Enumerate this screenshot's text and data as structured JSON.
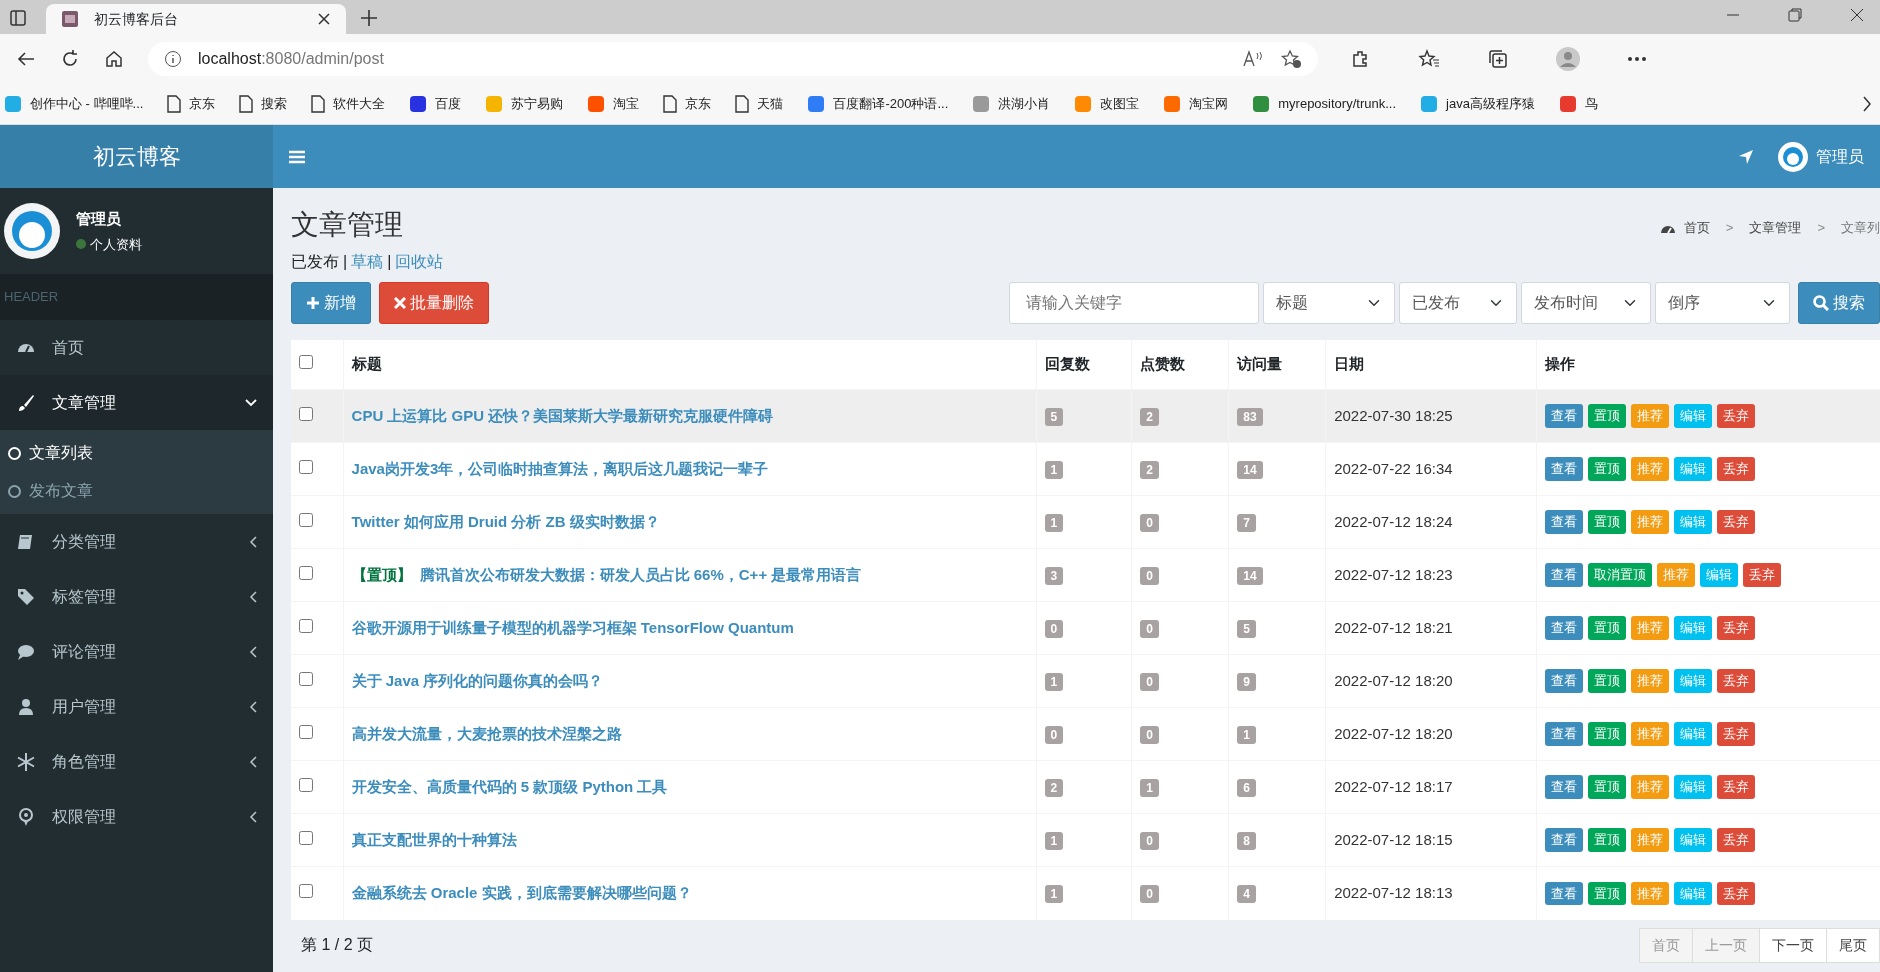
{
  "browser": {
    "tab_title": "初云博客后台",
    "url_host": "localhost",
    "url_rest": ":8080/admin/post",
    "bookmarks": [
      {
        "label": "创作中心 - 哔哩哔...",
        "kind": "site",
        "color": "#23ade5"
      },
      {
        "label": "京东",
        "kind": "page"
      },
      {
        "label": "搜索",
        "kind": "page"
      },
      {
        "label": "软件大全",
        "kind": "page"
      },
      {
        "label": "百度",
        "kind": "site",
        "color": "#2932e1"
      },
      {
        "label": "苏宁易购",
        "kind": "site",
        "color": "#f5b400"
      },
      {
        "label": "淘宝",
        "kind": "site",
        "color": "#ff5000"
      },
      {
        "label": "京东",
        "kind": "page"
      },
      {
        "label": "天猫",
        "kind": "page"
      },
      {
        "label": "百度翻译-200种语...",
        "kind": "site",
        "color": "#2e7cf6"
      },
      {
        "label": "洪湖小肖",
        "kind": "site",
        "color": "#9a9a9a"
      },
      {
        "label": "改图宝",
        "kind": "site",
        "color": "#ff8a00"
      },
      {
        "label": "淘宝网",
        "kind": "site",
        "color": "#ff6a00"
      },
      {
        "label": "myrepository/trunk...",
        "kind": "site",
        "color": "#2f8f3f"
      },
      {
        "label": "java高级程序猿",
        "kind": "site",
        "color": "#23ade5"
      },
      {
        "label": "鸟",
        "kind": "site",
        "color": "#e63b2e"
      }
    ]
  },
  "header": {
    "brand": "初云博客",
    "user": "管理员"
  },
  "sidebar": {
    "user": "管理员",
    "status": "个人资料",
    "section": "HEADER",
    "items": [
      {
        "label": "首页",
        "kind": "dashboard"
      },
      {
        "label": "文章管理",
        "kind": "brush",
        "expanded": true,
        "children": [
          {
            "label": "文章列表",
            "selected": true
          },
          {
            "label": "发布文章",
            "selected": false
          }
        ]
      },
      {
        "label": "分类管理",
        "kind": "book",
        "expanded": false
      },
      {
        "label": "标签管理",
        "kind": "tag",
        "expanded": false
      },
      {
        "label": "评论管理",
        "kind": "comment",
        "expanded": false
      },
      {
        "label": "用户管理",
        "kind": "user",
        "expanded": false
      },
      {
        "label": "角色管理",
        "kind": "snow",
        "expanded": false
      },
      {
        "label": "权限管理",
        "kind": "pin",
        "expanded": false
      }
    ]
  },
  "page": {
    "title": "文章管理",
    "breadcrumb": [
      "首页",
      "文章管理",
      "文章列"
    ],
    "breadcrumb_separators": [
      ">",
      ">"
    ],
    "filter_separators": [
      "|",
      "|"
    ],
    "filters": [
      {
        "label": "已发布",
        "selected": true
      },
      {
        "label": "草稿",
        "selected": false
      },
      {
        "label": "回收站",
        "selected": false
      }
    ],
    "add_button": "新增",
    "delete_button": "批量删除",
    "search": {
      "placeholder": "请输入关键字",
      "selects": [
        "标题",
        "已发布",
        "发布时间",
        "倒序"
      ],
      "button": "搜索"
    }
  },
  "table": {
    "select_all": {
      "checked": false
    },
    "columns": [
      "标题",
      "回复数",
      "点赞数",
      "访问量",
      "日期",
      "操作"
    ],
    "rows": [
      {
        "checked": false,
        "hovered": true,
        "title": "CPU 上运算比 GPU 还快？美国莱斯大学最新研究克服硬件障碍",
        "replies": "5",
        "likes": "2",
        "views": "83",
        "date": "2022-07-30 18:25",
        "actions": [
          {
            "label": "查看",
            "kind": "view"
          },
          {
            "label": "置顶",
            "kind": "pin"
          },
          {
            "label": "推荐",
            "kind": "recommend"
          },
          {
            "label": "编辑",
            "kind": "edit"
          },
          {
            "label": "丢弃",
            "kind": "discard"
          }
        ]
      },
      {
        "checked": false,
        "hovered": false,
        "title": "Java岗开发3年，公司临时抽查算法，离职后这几题我记一辈子",
        "replies": "1",
        "likes": "2",
        "views": "14",
        "date": "2022-07-22 16:34",
        "actions": [
          {
            "label": "查看",
            "kind": "view"
          },
          {
            "label": "置顶",
            "kind": "pin"
          },
          {
            "label": "推荐",
            "kind": "recommend"
          },
          {
            "label": "编辑",
            "kind": "edit"
          },
          {
            "label": "丢弃",
            "kind": "discard"
          }
        ]
      },
      {
        "checked": false,
        "hovered": false,
        "title": "Twitter 如何应用 Druid 分析 ZB 级实时数据？",
        "replies": "1",
        "likes": "0",
        "views": "7",
        "date": "2022-07-12 18:24",
        "actions": [
          {
            "label": "查看",
            "kind": "view"
          },
          {
            "label": "置顶",
            "kind": "pin"
          },
          {
            "label": "推荐",
            "kind": "recommend"
          },
          {
            "label": "编辑",
            "kind": "edit"
          },
          {
            "label": "丢弃",
            "kind": "discard"
          }
        ]
      },
      {
        "checked": false,
        "hovered": false,
        "tag": "【置顶】",
        "title": "腾讯首次公布研发大数据：研发人员占比 66%，C++ 是最常用语言",
        "replies": "3",
        "likes": "0",
        "views": "14",
        "date": "2022-07-12 18:23",
        "actions": [
          {
            "label": "查看",
            "kind": "view"
          },
          {
            "label": "取消置顶",
            "kind": "pin"
          },
          {
            "label": "推荐",
            "kind": "recommend"
          },
          {
            "label": "编辑",
            "kind": "edit"
          },
          {
            "label": "丢弃",
            "kind": "discard"
          }
        ]
      },
      {
        "checked": false,
        "hovered": false,
        "title": "谷歌开源用于训练量子模型的机器学习框架 TensorFlow Quantum",
        "replies": "0",
        "likes": "0",
        "views": "5",
        "date": "2022-07-12 18:21",
        "actions": [
          {
            "label": "查看",
            "kind": "view"
          },
          {
            "label": "置顶",
            "kind": "pin"
          },
          {
            "label": "推荐",
            "kind": "recommend"
          },
          {
            "label": "编辑",
            "kind": "edit"
          },
          {
            "label": "丢弃",
            "kind": "discard"
          }
        ]
      },
      {
        "checked": false,
        "hovered": false,
        "title": "关于 Java 序列化的问题你真的会吗？",
        "replies": "1",
        "likes": "0",
        "views": "9",
        "date": "2022-07-12 18:20",
        "actions": [
          {
            "label": "查看",
            "kind": "view"
          },
          {
            "label": "置顶",
            "kind": "pin"
          },
          {
            "label": "推荐",
            "kind": "recommend"
          },
          {
            "label": "编辑",
            "kind": "edit"
          },
          {
            "label": "丢弃",
            "kind": "discard"
          }
        ]
      },
      {
        "checked": false,
        "hovered": false,
        "title": "高并发大流量，大麦抢票的技术涅槃之路",
        "replies": "0",
        "likes": "0",
        "views": "1",
        "date": "2022-07-12 18:20",
        "actions": [
          {
            "label": "查看",
            "kind": "view"
          },
          {
            "label": "置顶",
            "kind": "pin"
          },
          {
            "label": "推荐",
            "kind": "recommend"
          },
          {
            "label": "编辑",
            "kind": "edit"
          },
          {
            "label": "丢弃",
            "kind": "discard"
          }
        ]
      },
      {
        "checked": false,
        "hovered": false,
        "title": "开发安全、高质量代码的 5 款顶级 Python 工具",
        "replies": "2",
        "likes": "1",
        "views": "6",
        "date": "2022-07-12 18:17",
        "actions": [
          {
            "label": "查看",
            "kind": "view"
          },
          {
            "label": "置顶",
            "kind": "pin"
          },
          {
            "label": "推荐",
            "kind": "recommend"
          },
          {
            "label": "编辑",
            "kind": "edit"
          },
          {
            "label": "丢弃",
            "kind": "discard"
          }
        ]
      },
      {
        "checked": false,
        "hovered": false,
        "title": "真正支配世界的十种算法",
        "replies": "1",
        "likes": "0",
        "views": "8",
        "date": "2022-07-12 18:15",
        "actions": [
          {
            "label": "查看",
            "kind": "view"
          },
          {
            "label": "置顶",
            "kind": "pin"
          },
          {
            "label": "推荐",
            "kind": "recommend"
          },
          {
            "label": "编辑",
            "kind": "edit"
          },
          {
            "label": "丢弃",
            "kind": "discard"
          }
        ]
      },
      {
        "checked": false,
        "hovered": false,
        "title": "金融系统去 Oracle 实践，到底需要解决哪些问题？",
        "replies": "1",
        "likes": "0",
        "views": "4",
        "date": "2022-07-12 18:13",
        "actions": [
          {
            "label": "查看",
            "kind": "view"
          },
          {
            "label": "置顶",
            "kind": "pin"
          },
          {
            "label": "推荐",
            "kind": "recommend"
          },
          {
            "label": "编辑",
            "kind": "edit"
          },
          {
            "label": "丢弃",
            "kind": "discard"
          }
        ]
      }
    ]
  },
  "pagination": {
    "summary": "第 1 / 2 页",
    "buttons": [
      {
        "label": "首页",
        "disabled": true
      },
      {
        "label": "上一页",
        "disabled": true
      },
      {
        "label": "下一页",
        "disabled": false
      },
      {
        "label": "尾页",
        "disabled": false
      }
    ]
  }
}
